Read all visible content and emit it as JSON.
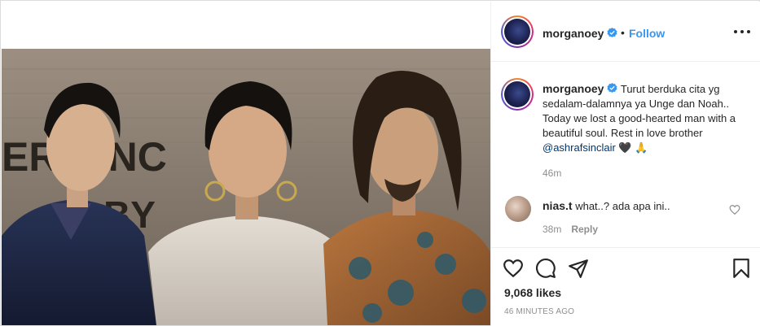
{
  "header": {
    "username": "morganoey",
    "separator": "•",
    "follow_label": "Follow"
  },
  "caption": {
    "username": "morganoey",
    "text_before_mention": "Turut berduka cita yg sedalam-dalamnya ya Unge dan Noah.. Today we lost a good-hearted man with a beautiful soul. Rest in love brother",
    "mention": "@ashrafsinclair",
    "emoji": "🖤 🙏",
    "time": "46m"
  },
  "comment": {
    "username": "nias.t",
    "text": "what..? ada apa ini..",
    "time": "38m",
    "reply_label": "Reply"
  },
  "actions": {
    "icons": [
      "heart-icon",
      "comment-icon",
      "share-icon",
      "bookmark-icon"
    ],
    "likes": "9,068 likes",
    "posted": "46 MINUTES AGO"
  },
  "photo": {
    "backdrop_text_line1": "ER  VINC",
    "backdrop_text_line2": "BY"
  },
  "colors": {
    "follow": "#3897f0",
    "verified": "#3897f0",
    "mention": "#00376b",
    "muted": "#8e8e8e",
    "text": "#262626"
  }
}
